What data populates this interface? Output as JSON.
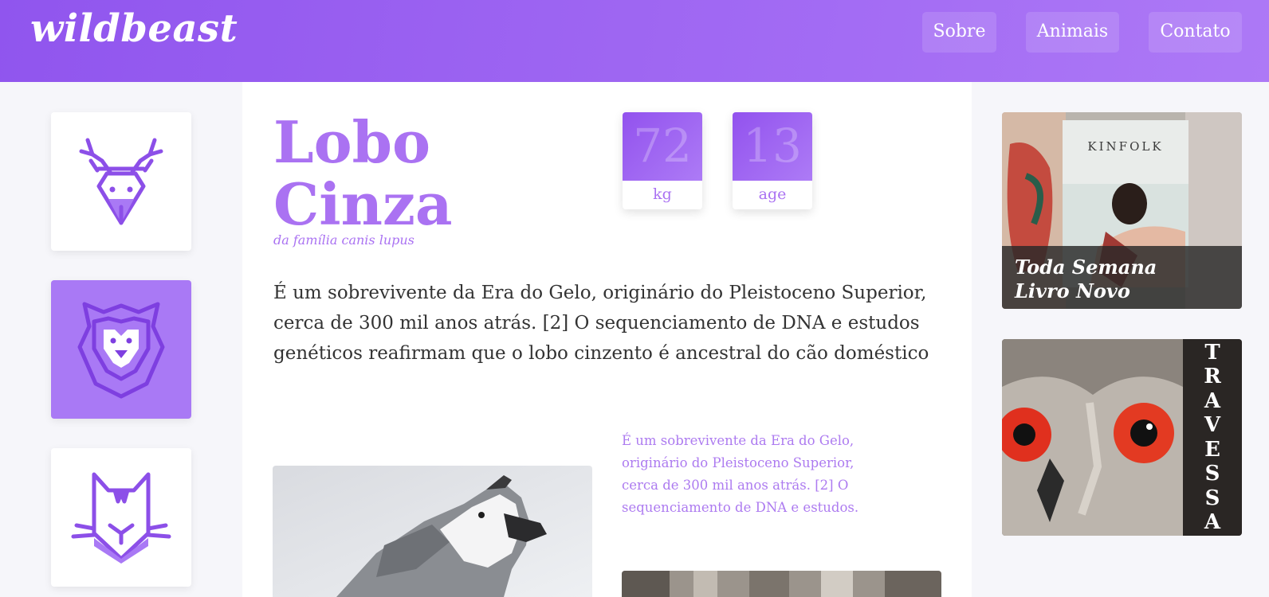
{
  "header": {
    "logo": "wildbeast",
    "nav": [
      "Sobre",
      "Animais",
      "Contato"
    ]
  },
  "sidebar": {
    "items": [
      {
        "icon": "deer-icon",
        "active": false
      },
      {
        "icon": "lion-icon",
        "active": true
      },
      {
        "icon": "cat-icon",
        "active": false
      }
    ]
  },
  "animal": {
    "title_line1": "Lobo",
    "title_line2": "Cinza",
    "subtitle": "da família canis lupus",
    "stats": [
      {
        "value": "72",
        "label": "kg"
      },
      {
        "value": "13",
        "label": "age"
      }
    ],
    "description": "É um sobrevivente da Era do Gelo, originário do Pleistoceno Superior, cerca de 300 mil anos atrás. [2] O sequenciamento de DNA e estudos genéticos reafirmam que o lobo cinzento é ancestral do cão doméstico",
    "side_note": "É um sobrevivente da Era do Gelo, originário do Pleistoceno Superior, cerca de 300 mil anos atrás. [2] O sequenciamento de DNA e estudos."
  },
  "ads": {
    "kinfolk": {
      "magazine": "KINFOLK",
      "caption_line1": "Toda Semana",
      "caption_line2": "Livro Novo"
    },
    "owl": {
      "letters": [
        "T",
        "R",
        "A",
        "V",
        "E",
        "S",
        "S",
        "A"
      ]
    }
  },
  "colors": {
    "accent": "#aa72f2",
    "header_start": "#9055ee",
    "header_end": "#ad79f6"
  }
}
